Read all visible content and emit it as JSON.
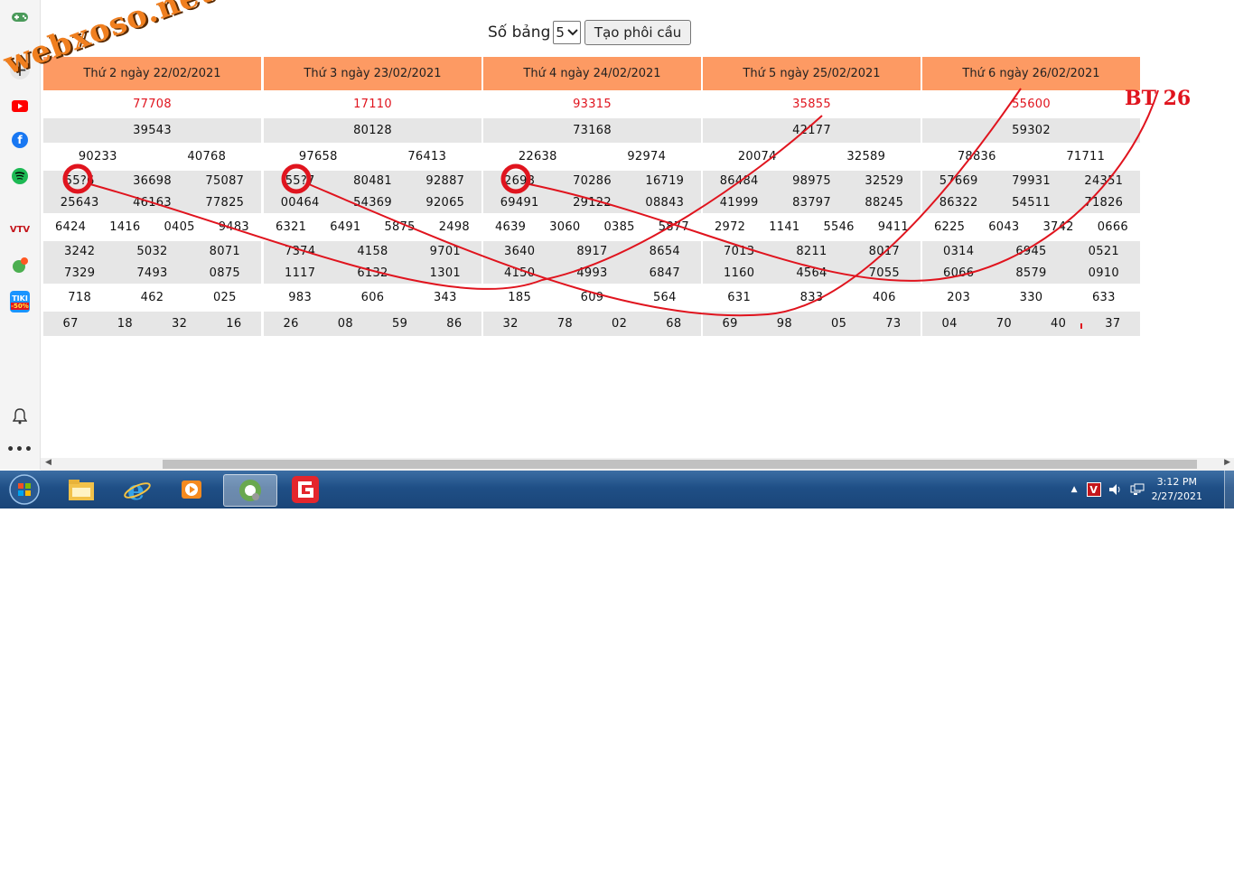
{
  "toolbar": {
    "so_bang_label": "Số bảng",
    "so_bang_value": "5",
    "create_button": "Tạo phôi cầu"
  },
  "tables": [
    {
      "header": "Thứ 2 ngày 22/02/2021",
      "rows": [
        [
          "77708"
        ],
        [
          "39543"
        ],
        [
          "90233",
          "40768"
        ],
        [
          "55?6",
          "36698",
          "75087",
          "25643",
          "46163",
          "77825"
        ],
        [
          "6424",
          "1416",
          "0405",
          "9483"
        ],
        [
          "3242",
          "5032",
          "8071",
          "7329",
          "7493",
          "0875"
        ],
        [
          "718",
          "462",
          "025"
        ],
        [
          "67",
          "18",
          "32",
          "16"
        ]
      ]
    },
    {
      "header": "Thứ 3 ngày 23/02/2021",
      "rows": [
        [
          "17110"
        ],
        [
          "80128"
        ],
        [
          "97658",
          "76413"
        ],
        [
          "55?7",
          "80481",
          "92887",
          "00464",
          "54369",
          "92065"
        ],
        [
          "6321",
          "6491",
          "5875",
          "2498"
        ],
        [
          "7374",
          "4158",
          "9701",
          "1117",
          "6132",
          "1301"
        ],
        [
          "983",
          "606",
          "343"
        ],
        [
          "26",
          "08",
          "59",
          "86"
        ]
      ]
    },
    {
      "header": "Thứ 4 ngày 24/02/2021",
      "rows": [
        [
          "93315"
        ],
        [
          "73168"
        ],
        [
          "22638",
          "92974"
        ],
        [
          "2693",
          "70286",
          "16719",
          "69491",
          "29122",
          "08843"
        ],
        [
          "4639",
          "3060",
          "0385",
          "5877"
        ],
        [
          "3640",
          "8917",
          "8654",
          "4150",
          "4993",
          "6847"
        ],
        [
          "185",
          "609",
          "564"
        ],
        [
          "32",
          "78",
          "02",
          "68"
        ]
      ]
    },
    {
      "header": "Thứ 5 ngày 25/02/2021",
      "rows": [
        [
          "35855"
        ],
        [
          "42177"
        ],
        [
          "20074",
          "32589"
        ],
        [
          "86484",
          "98975",
          "32529",
          "41999",
          "83797",
          "88245"
        ],
        [
          "2972",
          "1141",
          "5546",
          "9411"
        ],
        [
          "7013",
          "8211",
          "8017",
          "1160",
          "4564",
          "7055"
        ],
        [
          "631",
          "833",
          "406"
        ],
        [
          "69",
          "98",
          "05",
          "73"
        ]
      ]
    },
    {
      "header": "Thứ 6 ngày 26/02/2021",
      "rows": [
        [
          "55600"
        ],
        [
          "59302"
        ],
        [
          "78836",
          "71711"
        ],
        [
          "57669",
          "79931",
          "24351",
          "86322",
          "54511",
          "71826"
        ],
        [
          "6225",
          "6043",
          "3742",
          "0666"
        ],
        [
          "0314",
          "6945",
          "0521",
          "6066",
          "8579",
          "0910"
        ],
        [
          "203",
          "330",
          "633"
        ],
        [
          "04",
          "70",
          "40",
          "37"
        ]
      ]
    }
  ],
  "watermark": "webxoso.net",
  "annotation_label": "BT 26",
  "clock": {
    "time": "3:12 PM",
    "date": "2/27/2021"
  },
  "colors": {
    "header_bg": "#fd9a63",
    "special_prize": "#e0141e",
    "annotation": "#e0141e",
    "watermark": "#f07f1f"
  },
  "sidebar_icons": [
    "gamepad-icon",
    "add-icon",
    "youtube-icon",
    "facebook-icon",
    "spotify-icon",
    "vtv-go-icon",
    "games-icon",
    "tiki-icon",
    "bell-icon",
    "more-icon"
  ],
  "taskbar_icons": [
    "start-orb-icon",
    "explorer-icon",
    "internet-explorer-icon",
    "media-player-icon",
    "coccoc-browser-icon",
    "garena-icon"
  ]
}
